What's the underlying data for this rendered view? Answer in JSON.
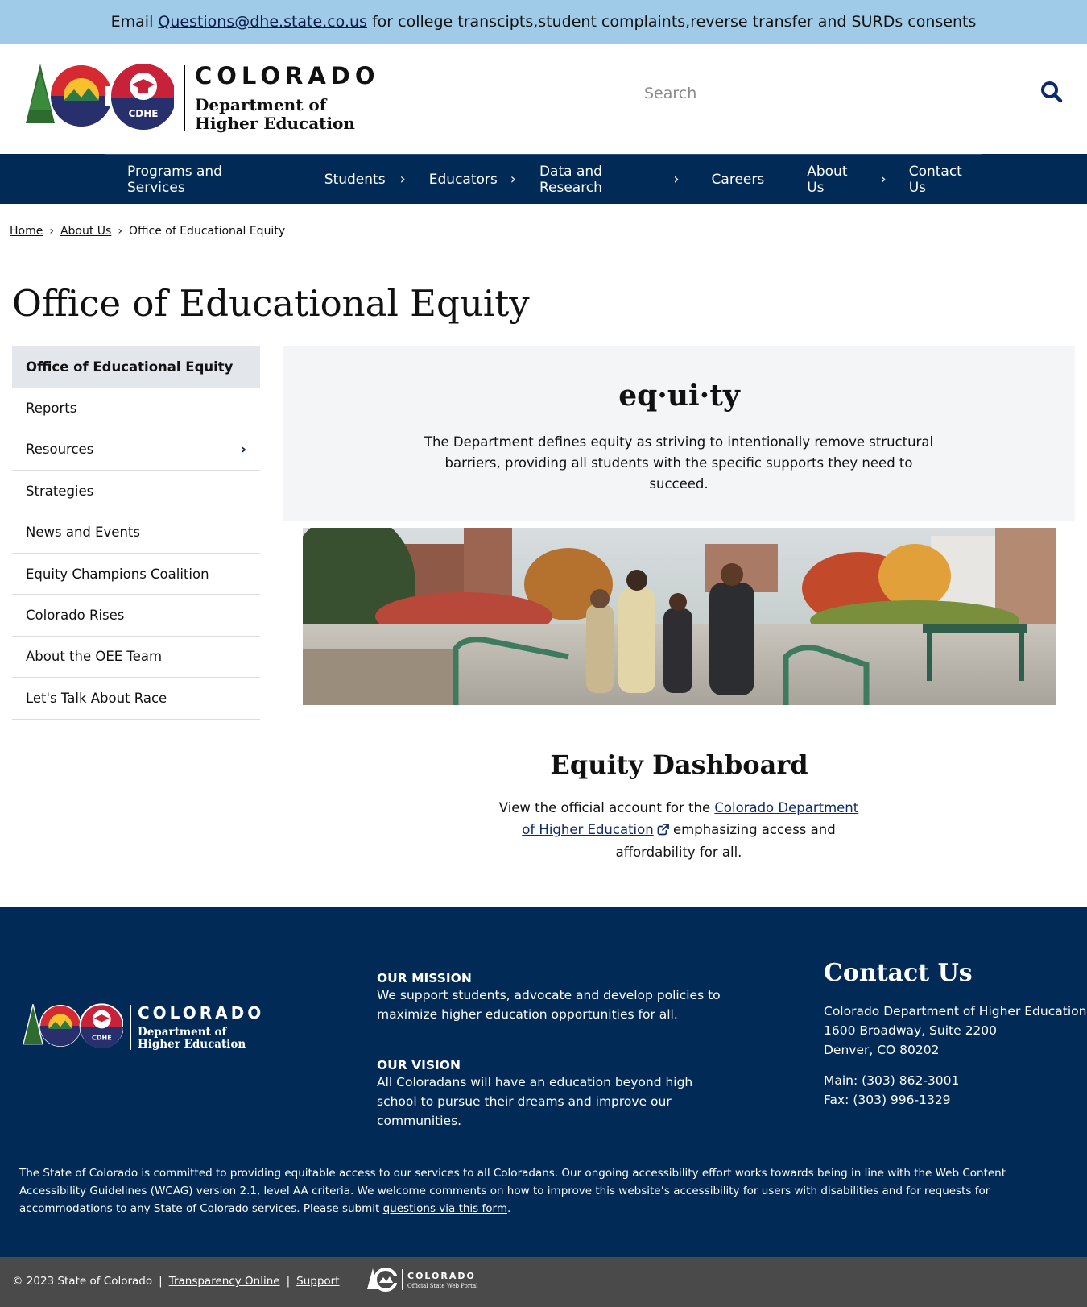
{
  "alert": {
    "prefix": "Email",
    "email": "Questions@dhe.state.co.us",
    "suffix": "for college transcipts,student complaints,reverse transfer and SURDs consents"
  },
  "header": {
    "logo_state": "COLORADO",
    "logo_dept_line1": "Department of",
    "logo_dept_line2": "Higher Education",
    "logo_badge": "CDHE",
    "search_placeholder": "Search"
  },
  "nav": {
    "items": [
      {
        "label": "Programs and Services",
        "has_submenu": false
      },
      {
        "label": "Students",
        "has_submenu": true
      },
      {
        "label": "Educators",
        "has_submenu": true
      },
      {
        "label": "Data and Research",
        "has_submenu": true
      },
      {
        "label": "Careers",
        "has_submenu": false
      },
      {
        "label": "About Us",
        "has_submenu": true
      },
      {
        "label": "Contact Us",
        "has_submenu": false
      }
    ]
  },
  "breadcrumb": {
    "home": "Home",
    "about": "About Us",
    "current": "Office of Educational Equity"
  },
  "page": {
    "title": "Office of Educational Equity"
  },
  "sidebar": {
    "items": [
      {
        "label": "Office of Educational Equity",
        "active": true
      },
      {
        "label": "Reports"
      },
      {
        "label": "Resources",
        "has_submenu": true
      },
      {
        "label": "Strategies"
      },
      {
        "label": "News and Events"
      },
      {
        "label": "Equity Champions Coalition"
      },
      {
        "label": "Colorado Rises"
      },
      {
        "label": "About the OEE Team"
      },
      {
        "label": "Let's Talk About Race"
      }
    ]
  },
  "equity": {
    "word": "eq·ui·ty",
    "definition": "The Department defines equity as striving to intentionally remove structural barriers, providing all students with the specific supports they need to succeed."
  },
  "dashboard": {
    "title": "Equity Dashboard",
    "text_before": "View the official account for the",
    "link": "Colorado Department of Higher Education",
    "text_after": "emphasizing access and affordability for all."
  },
  "footer": {
    "mission_heading": "OUR MISSION",
    "mission_text": "We support students, advocate and develop policies to maximize higher education opportunities for all.",
    "vision_heading": "OUR VISION",
    "vision_text": "All Coloradans will have an education beyond high school to pursue their dreams and improve our communities.",
    "contact_title": "Contact Us",
    "address_line1": "Colorado Department of Higher Education",
    "address_line2": "1600 Broadway, Suite 2200",
    "address_line3": "Denver, CO 80202",
    "main_phone": "Main: (303) 862-3001",
    "fax": "Fax: (303) 996-1329",
    "a11y_text": "The State of Colorado is committed to providing equitable access to our services to all Coloradans. Our ongoing accessibility effort works towards being in line with the Web Content Accessibility Guidelines (WCAG) version 2.1, level AA criteria. We welcome comments on how to improve this website’s accessibility for users with disabilities and for requests for accommodations to any State of Colorado services. Please submit",
    "a11y_link": "questions via this form",
    "a11y_end": "."
  },
  "bottombar": {
    "copyright": "© 2023 State of Colorado",
    "transparency": "Transparency Online",
    "support": "Support",
    "portal_state": "COLORADO",
    "portal_sub": "Official State Web Portal"
  },
  "colors": {
    "alert_bg": "#9fcbe8",
    "nav_bg": "#012a56",
    "footer_bg": "#012a56",
    "bottombar_bg": "#4a4a4a",
    "link": "#0b2a6b",
    "sidebar_active_bg": "#e3e6ea",
    "equity_box_bg": "#f4f5f6"
  },
  "icons": {
    "search": "search-icon",
    "chevron": "chevron-right-icon",
    "external": "external-link-icon"
  }
}
